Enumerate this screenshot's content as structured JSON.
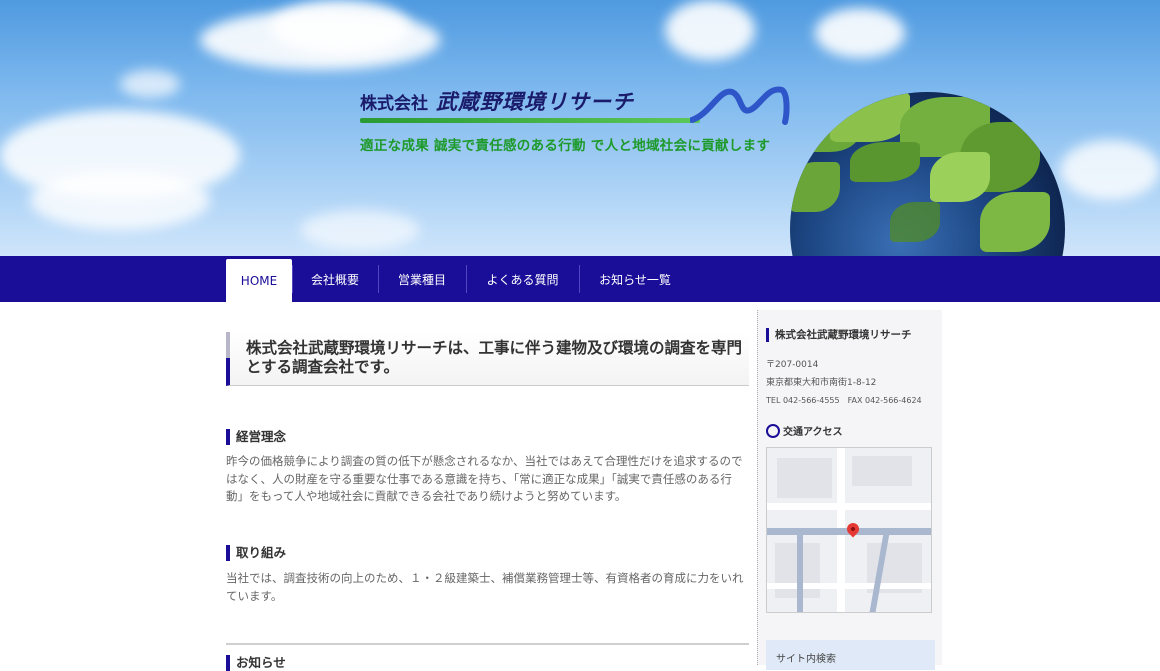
{
  "header": {
    "company_prefix": "株式会社",
    "company_name": "武蔵野環境リサーチ",
    "tagline": "適正な成果 誠実で責任感のある行動 で人と地域社会に貢献します"
  },
  "nav": {
    "items": [
      {
        "label": "HOME"
      },
      {
        "label": "会社概要"
      },
      {
        "label": "営業種目"
      },
      {
        "label": "よくある質問"
      },
      {
        "label": "お知らせ一覧"
      }
    ]
  },
  "main": {
    "lead": "株式会社武蔵野環境リサーチは、工事に伴う建物及び環境の調査を専門とする調査会社です。",
    "sections": [
      {
        "title": "経営理念",
        "body": "昨今の価格競争により調査の質の低下が懸念されるなか、当社ではあえて合理性だけを追求するのではなく、人の財産を守る重要な仕事である意識を持ち、「常に適正な成果」「誠実で責任感のある行動」をもって人や地域社会に貢献できる会社であり続けようと努めています。"
      },
      {
        "title": "取り組み",
        "body": "当社では、調査技術の向上のため、１・２級建築士、補償業務管理士等、有資格者の育成に力をいれています。"
      },
      {
        "title": "お知らせ",
        "body": ""
      }
    ]
  },
  "sidebar": {
    "company": "株式会社武蔵野環境リサーチ",
    "postal": "〒207-0014",
    "address": "東京都東大和市南街1-8-12",
    "tel_fax": "TEL 042-566-4555　FAX 042-566-4624",
    "access_label": "交通アクセス",
    "search_label": "サイト内検索"
  },
  "colors": {
    "nav_bg": "#1a0d98",
    "tagline_green": "#1d9a2a",
    "logo_navy": "#1b1b6b"
  }
}
